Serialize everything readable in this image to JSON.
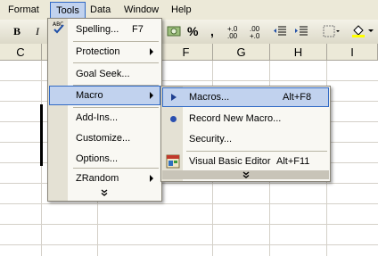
{
  "menubar": {
    "items": [
      "Format",
      "Tools",
      "Data",
      "Window",
      "Help"
    ]
  },
  "toolbar": {
    "bold": "B",
    "italic": "I",
    "percent": "%",
    "comma": ",",
    "increase_decimal": "+.0 .00",
    "decrease_decimal": ".00 +.0"
  },
  "columns": [
    "C",
    "F",
    "G",
    "H",
    "I"
  ],
  "tools_menu": {
    "items": [
      {
        "label": "Spelling...",
        "shortcut": "F7"
      },
      {
        "label": "Protection",
        "submenu": true
      },
      {
        "label": "Goal Seek..."
      },
      {
        "label": "Macro",
        "submenu": true,
        "highlighted": true
      },
      {
        "label": "Add-Ins..."
      },
      {
        "label": "Customize..."
      },
      {
        "label": "Options..."
      },
      {
        "label": "ZRandom",
        "submenu": true
      }
    ],
    "more": "⌄"
  },
  "macro_menu": {
    "items": [
      {
        "label": "Macros...",
        "shortcut": "Alt+F8",
        "highlighted": true
      },
      {
        "label": "Record New Macro..."
      },
      {
        "label": "Security..."
      },
      {
        "label": "Visual Basic Editor",
        "shortcut": "Alt+F11"
      }
    ],
    "more": "⌄"
  },
  "colors": {
    "menu_bg": "#f9f8f3",
    "highlight": "#c1d2ee",
    "highlight_border": "#316ac5",
    "menubar_bg": "#ece9d8"
  }
}
